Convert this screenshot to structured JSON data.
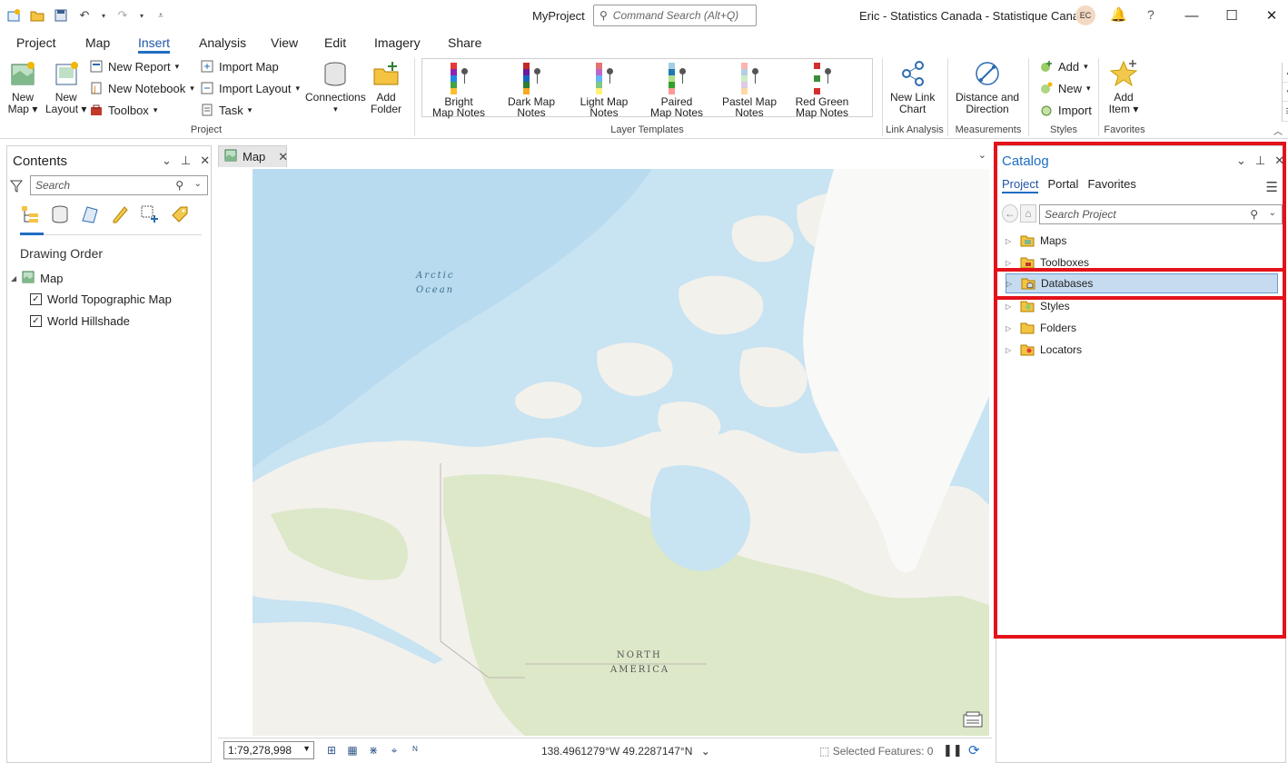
{
  "app": {
    "project_name": "MyProject",
    "command_search_placeholder": "Command Search (Alt+Q)",
    "user": "Eric - Statistics Canada - Statistique Canada",
    "avatar_initials": "EC",
    "help": "?"
  },
  "ribbon_tabs": [
    "Project",
    "Map",
    "Insert",
    "Analysis",
    "View",
    "Edit",
    "Imagery",
    "Share"
  ],
  "active_tab": "Insert",
  "ribbon": {
    "project_group": {
      "label": "Project",
      "new_map": "New Map",
      "new_layout": "New Layout",
      "new_report": "New Report",
      "new_notebook": "New Notebook",
      "toolbox": "Toolbox",
      "import_map": "Import Map",
      "import_layout": "Import Layout",
      "task": "Task",
      "connections": "Connections",
      "add_folder": "Add Folder"
    },
    "layer_templates": {
      "label": "Layer Templates",
      "items": [
        {
          "line1": "Bright",
          "line2": "Map Notes"
        },
        {
          "line1": "Dark Map",
          "line2": "Notes"
        },
        {
          "line1": "Light Map",
          "line2": "Notes"
        },
        {
          "line1": "Paired",
          "line2": "Map Notes"
        },
        {
          "line1": "Pastel Map",
          "line2": "Notes"
        },
        {
          "line1": "Red Green",
          "line2": "Map Notes"
        }
      ]
    },
    "link_analysis": {
      "label": "Link Analysis",
      "new_link_chart_1": "New Link",
      "new_link_chart_2": "Chart"
    },
    "measurements": {
      "label": "Measurements",
      "distance_1": "Distance and",
      "distance_2": "Direction"
    },
    "styles": {
      "label": "Styles",
      "add": "Add",
      "new": "New",
      "import": "Import"
    },
    "favorites": {
      "label": "Favorites",
      "add_item_1": "Add",
      "add_item_2": "Item"
    }
  },
  "contents": {
    "title": "Contents",
    "search_placeholder": "Search",
    "drawing_order": "Drawing Order",
    "map": "Map",
    "layers": [
      {
        "name": "World Topographic Map",
        "checked": true
      },
      {
        "name": "World Hillshade",
        "checked": true
      }
    ]
  },
  "map_view": {
    "tab_label": "Map",
    "labels": {
      "arctic_1": "Arctic",
      "arctic_2": "Ocean",
      "na_1": "NORTH",
      "na_2": "AMERICA"
    },
    "scale": "1:79,278,998",
    "coordinates": "138.4961279°W 49.2287147°N",
    "selected_features": "Selected Features: 0"
  },
  "catalog": {
    "title": "Catalog",
    "tabs": [
      "Project",
      "Portal",
      "Favorites"
    ],
    "search_placeholder": "Search Project",
    "items": [
      "Maps",
      "Toolboxes",
      "Databases",
      "Styles",
      "Folders",
      "Locators"
    ],
    "selected_item": "Databases"
  },
  "colors": {
    "accent": "#1f6ec2",
    "highlight_box": "#e3121b",
    "water": "#c8e3f2",
    "land": "#f2f1ec",
    "vegetation": "#dce8c8"
  }
}
